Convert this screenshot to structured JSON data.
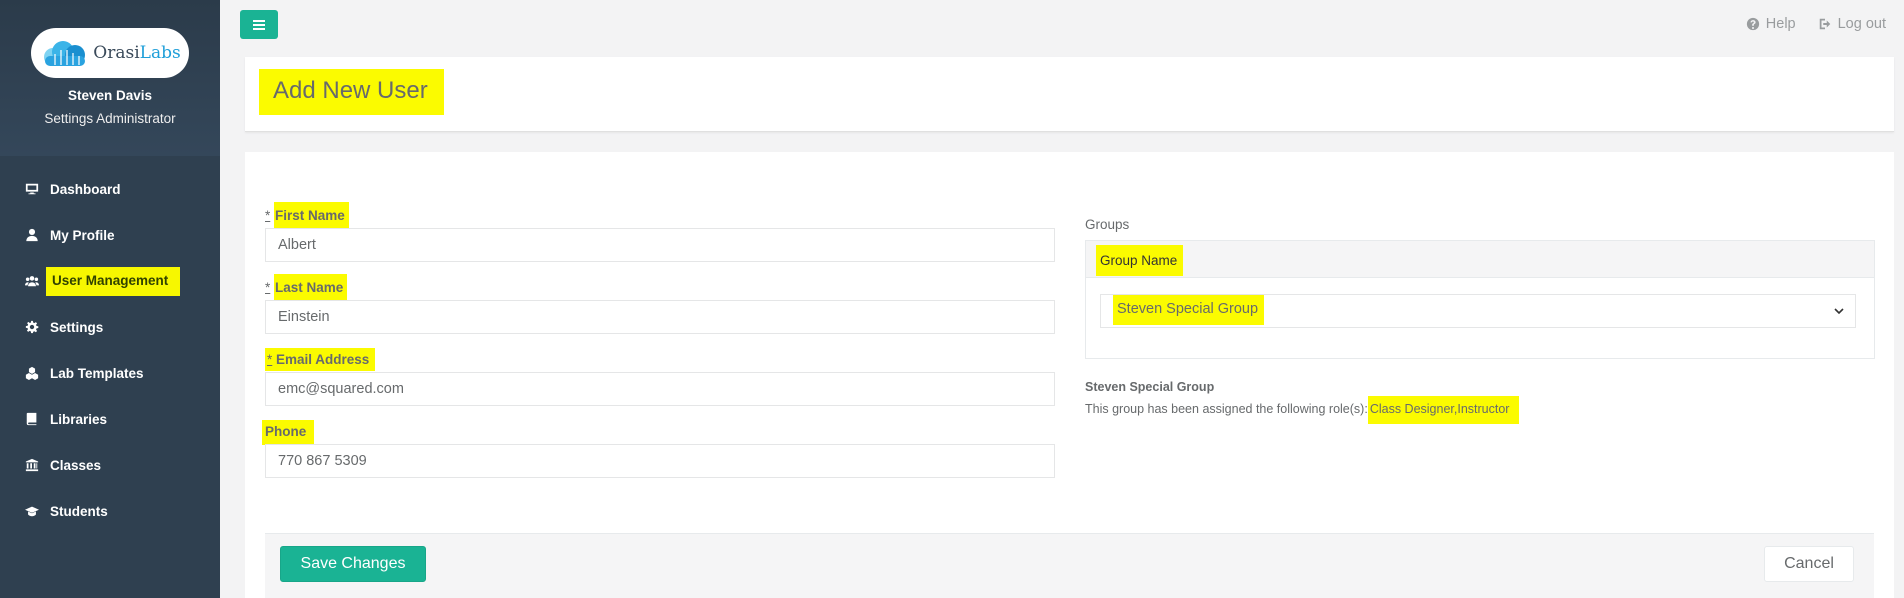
{
  "app": {
    "logo_text_main": "Orasi",
    "logo_text_accent": "Labs",
    "logo_icon": "cloud-logo-icon"
  },
  "user": {
    "name": "Steven Davis",
    "role": "Settings Administrator"
  },
  "sidebar": {
    "items": [
      {
        "label": "Dashboard",
        "icon": "monitor-icon"
      },
      {
        "label": "My Profile",
        "icon": "user-icon"
      },
      {
        "label": "User Management",
        "icon": "users-icon",
        "active": true
      },
      {
        "label": "Settings",
        "icon": "gear-icon"
      },
      {
        "label": "Lab Templates",
        "icon": "cubes-icon"
      },
      {
        "label": "Libraries",
        "icon": "book-icon"
      },
      {
        "label": "Classes",
        "icon": "institution-icon"
      },
      {
        "label": "Students",
        "icon": "graduation-cap-icon"
      }
    ]
  },
  "topbar": {
    "menu_icon": "hamburger-icon",
    "help_label": "Help",
    "logout_label": "Log out"
  },
  "page": {
    "title": "Add New User"
  },
  "form": {
    "required_marker": "*",
    "first_name": {
      "label": "First Name",
      "value": "Albert"
    },
    "last_name": {
      "label": "Last Name",
      "value": "Einstein"
    },
    "email": {
      "label": "Email Address",
      "value": "emc@squared.com"
    },
    "phone": {
      "label": "Phone",
      "value": "770 867 5309"
    }
  },
  "groups": {
    "section_label": "Groups",
    "column_header": "Group Name",
    "selected": "Steven Special Group",
    "info_title": "Steven Special Group",
    "info_text": "This group has been assigned the following role(s):",
    "roles": "Class Designer,Instructor"
  },
  "actions": {
    "save_label": "Save Changes",
    "cancel_label": "Cancel"
  },
  "colors": {
    "sidebar_bg": "#2f4050",
    "accent": "#1ab394",
    "highlight": "#fbfb00"
  }
}
